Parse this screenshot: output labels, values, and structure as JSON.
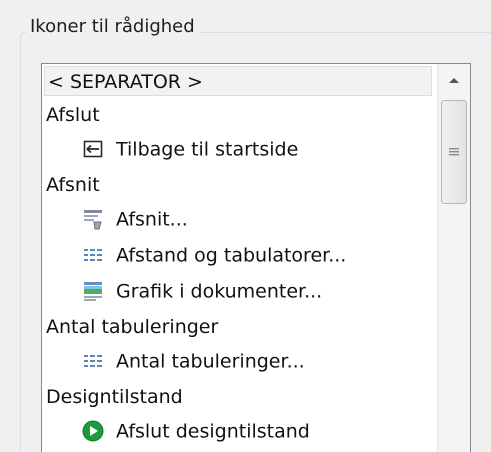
{
  "group": {
    "title": "Ikoner til rådighed"
  },
  "list": {
    "rows": [
      {
        "type": "selected",
        "label": "< SEPARATOR >"
      },
      {
        "type": "category",
        "label": "Afslut"
      },
      {
        "type": "item",
        "label": "Tilbage til startside",
        "icon": "return-arrow-icon"
      },
      {
        "type": "category",
        "label": "Afsnit"
      },
      {
        "type": "item",
        "label": "Afsnit...",
        "icon": "paragraph-format-icon"
      },
      {
        "type": "item",
        "label": "Afstand og tabulatorer...",
        "icon": "dotted-grid-icon"
      },
      {
        "type": "item",
        "label": "Grafik i dokumenter...",
        "icon": "picture-in-document-icon"
      },
      {
        "type": "category",
        "label": "Antal tabuleringer"
      },
      {
        "type": "item",
        "label": "Antal tabuleringer...",
        "icon": "dotted-grid-icon"
      },
      {
        "type": "category",
        "label": "Designtilstand"
      },
      {
        "type": "item",
        "label": "Afslut designtilstand",
        "icon": "green-play-circle-icon"
      }
    ]
  },
  "colors": {
    "accent_blue": "#2b6fb6",
    "icon_green": "#1f9a3a",
    "selection_bg": "#f2f2f2"
  }
}
